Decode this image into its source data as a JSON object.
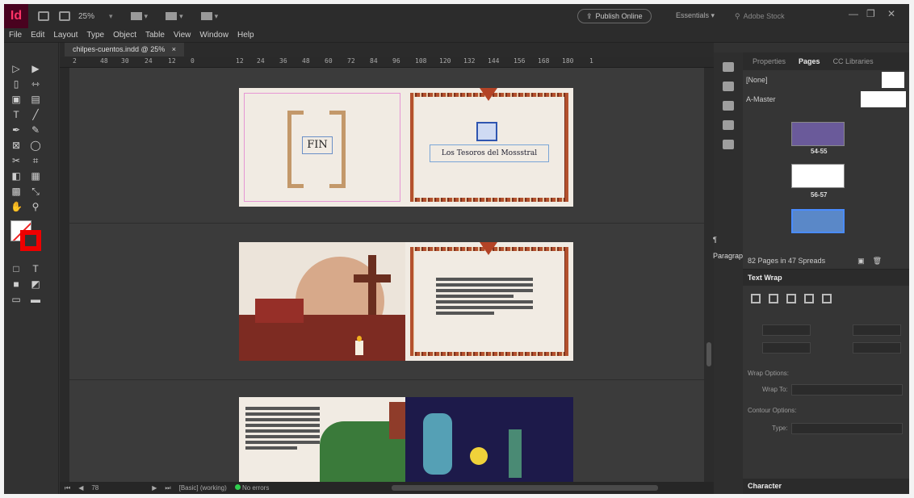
{
  "app": {
    "logo": "Id",
    "zoom": "25%",
    "publish_label": "Publish Online",
    "workspace": "Essentials",
    "search_placeholder": "Adobe Stock"
  },
  "menu": [
    "File",
    "Edit",
    "Layout",
    "Type",
    "Object",
    "Table",
    "View",
    "Window",
    "Help"
  ],
  "document": {
    "tab_title": "chilpes-cuentos.indd @ 25%",
    "tab_close": "×"
  },
  "ruler_marks": [
    "2",
    "48",
    "30",
    "24",
    "12",
    "0",
    "12",
    "24",
    "36",
    "48",
    "60",
    "72",
    "84",
    "96",
    "108",
    "120",
    "132",
    "144",
    "156",
    "168",
    "180",
    "1"
  ],
  "spreads": {
    "fin_text": "FIN",
    "book_title": "Los Tesoros del Mossstral"
  },
  "statusbar": {
    "page": "78",
    "profile": "[Basic] (working)",
    "errors": "No errors"
  },
  "panels": {
    "tabs": [
      "Properties",
      "Pages",
      "CC Libraries"
    ],
    "active_tab": "Pages",
    "masters": [
      "[None]",
      "A-Master"
    ],
    "spread_labels": [
      "54-55",
      "56-57"
    ],
    "pages_footer": "82 Pages in 47 Spreads",
    "paragraph_label": "Paragrap...",
    "text_wrap_title": "Text Wrap",
    "wrap_options_label": "Wrap Options:",
    "wrap_to_label": "Wrap To:",
    "contour_options_label": "Contour Options:",
    "type_label": "Type:",
    "character_title": "Character"
  },
  "colors": {
    "accent": "#ff3366",
    "stroke_swatch": "#e00000",
    "frame_border": "#b4512e"
  }
}
